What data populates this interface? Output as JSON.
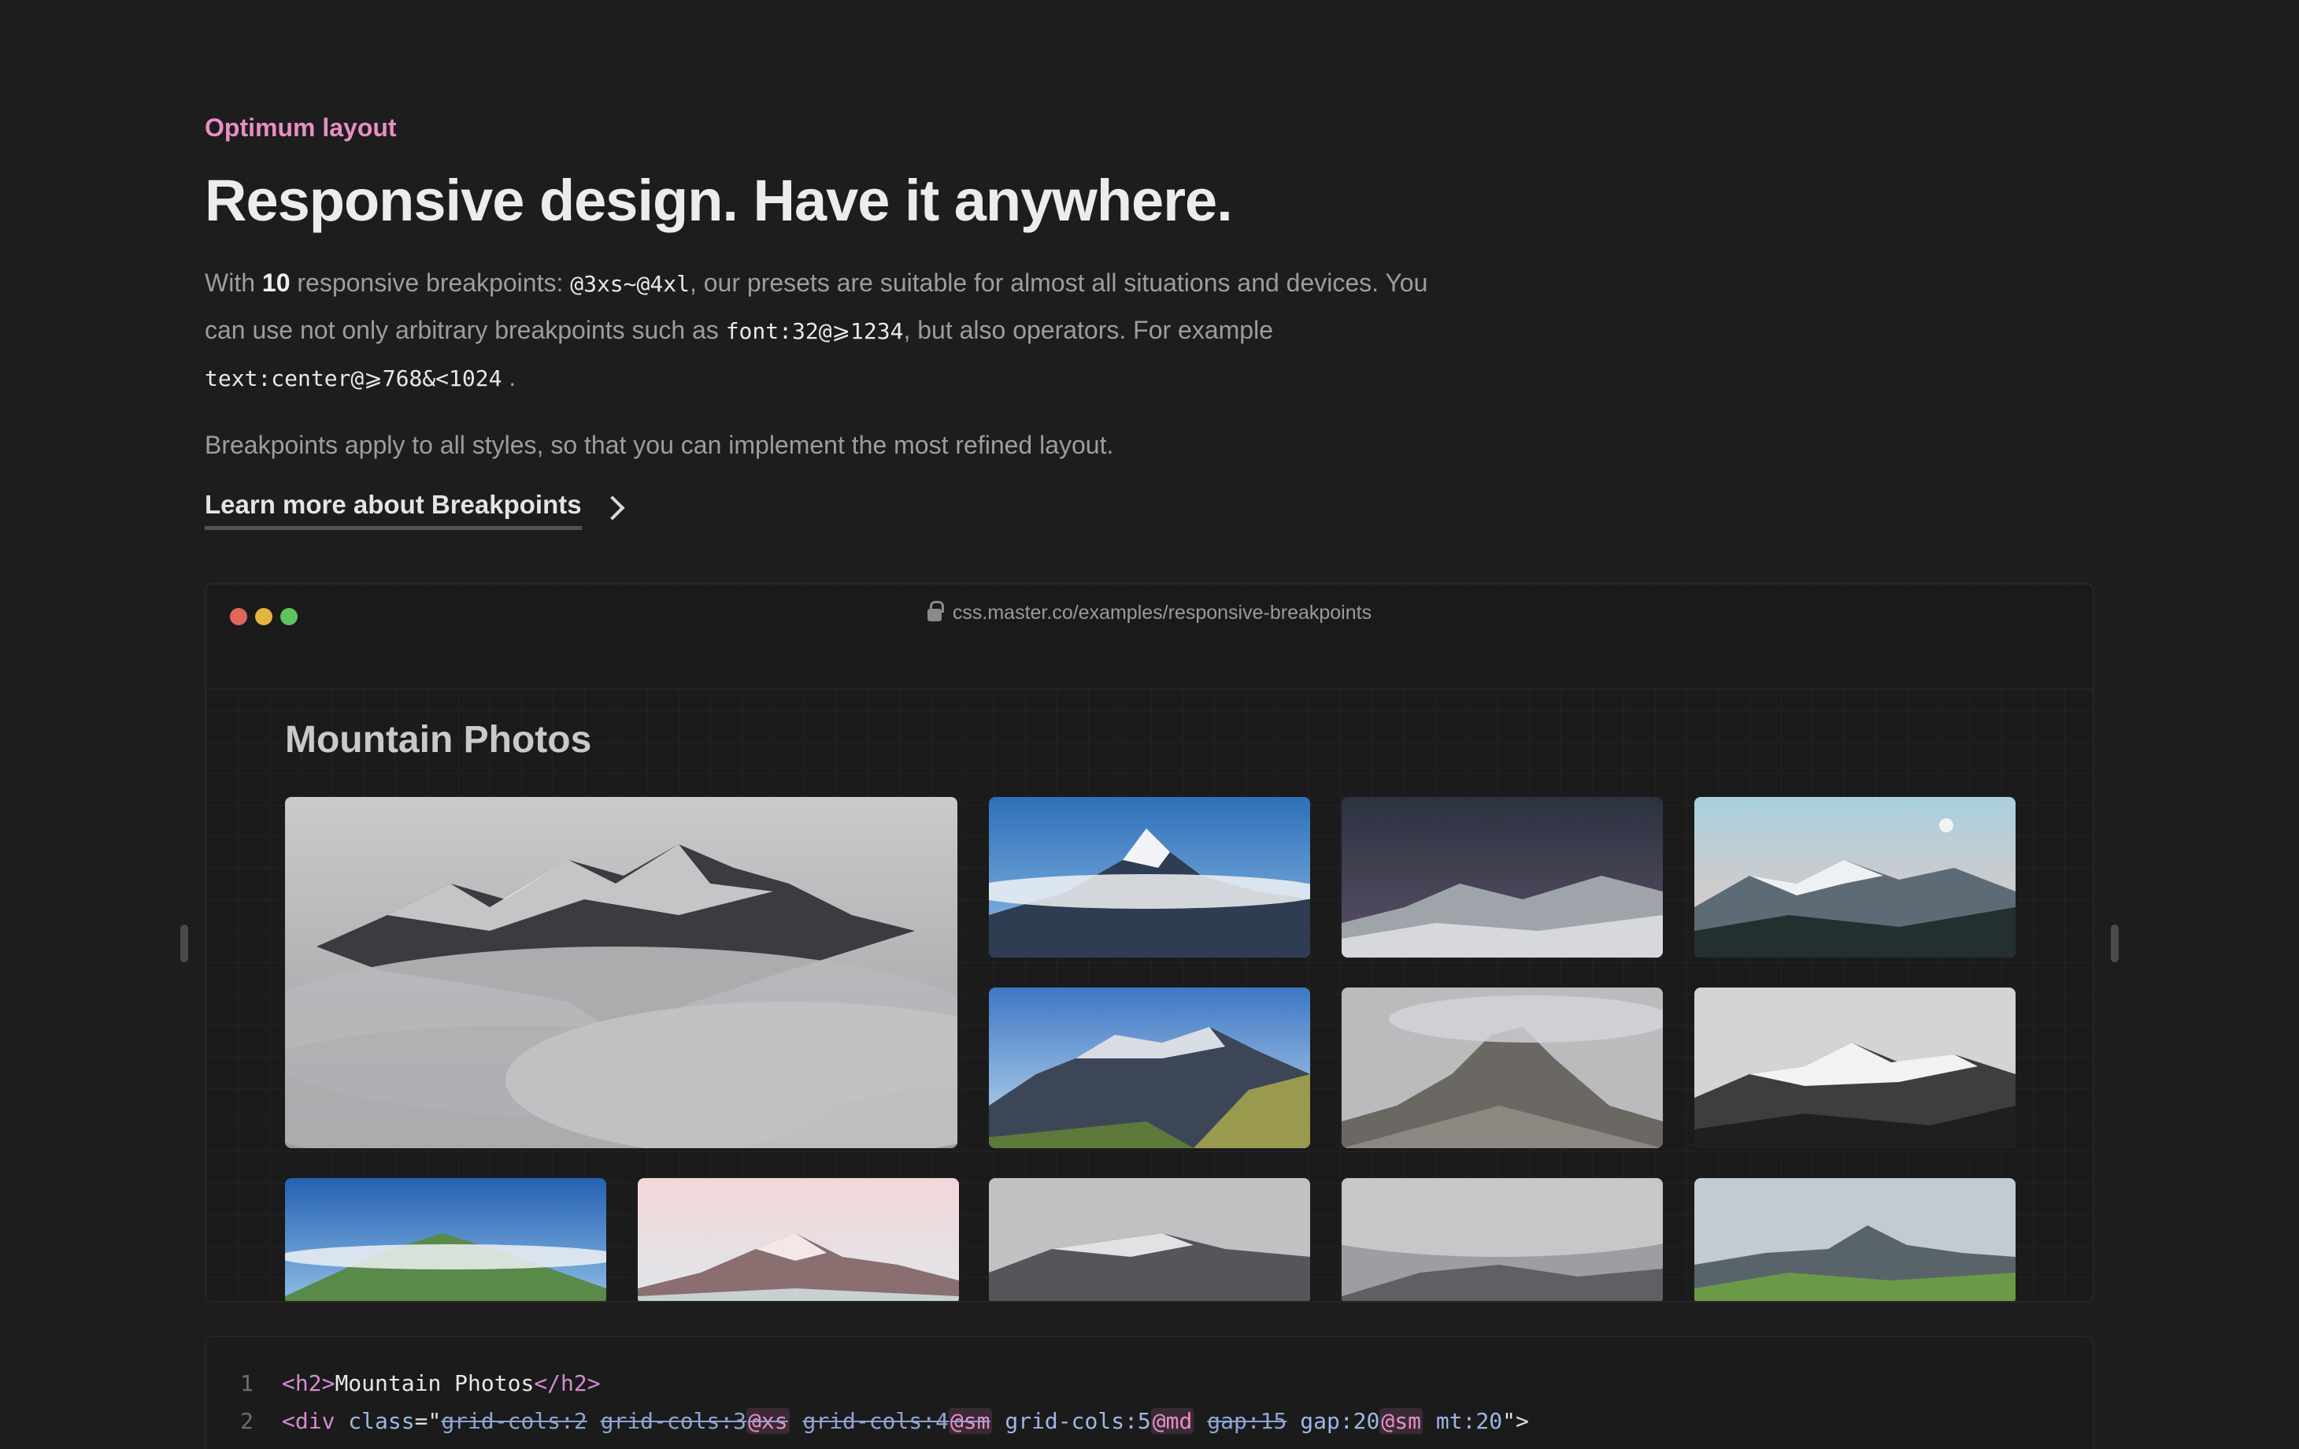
{
  "section": {
    "eyebrow": "Optimum layout",
    "headline": "Responsive design. Have it anywhere.",
    "p1_a": "With ",
    "p1_count": "10",
    "p1_b": " responsive breakpoints: ",
    "p1_code1": "@3xs~@4xl",
    "p1_c": ", our presets are suitable for almost all situations and devices. You can use not only arbitrary breakpoints such as ",
    "p1_code2": "font:32@⩾1234",
    "p1_d": ", but also operators. For example ",
    "p1_code3": "text:center@⩾768&<1024",
    "p1_e": " .",
    "p2": "Breakpoints apply to all styles, so that you can implement the most refined layout.",
    "learn_more": "Learn more about Breakpoints"
  },
  "browser": {
    "url": "css.master.co/examples/responsive-breakpoints",
    "gallery_title": "Mountain Photos"
  },
  "code": {
    "line1_no": "1",
    "line1_open": "<h2>",
    "line1_text": "Mountain Photos",
    "line1_close": "</h2>",
    "line2_no": "2",
    "line2_tag": "<div ",
    "line2_attr": "class",
    "line2_eq": "=\"",
    "line2_s1": "grid-cols:2",
    "line2_s2a": "grid-cols:3",
    "line2_s2b": "@xs",
    "line2_s3a": "grid-cols:4",
    "line2_s3b": "@sm",
    "line2_c1a": "grid-cols:5",
    "line2_c1b": "@md",
    "line2_s4": "gap:15",
    "line2_c2a": "gap:20",
    "line2_c2b": "@sm",
    "line2_c3": "mt:20",
    "line2_end": "\">"
  },
  "colors": {
    "accent": "#e88ec6",
    "background": "#1d1d1d",
    "dot_red": "#e0675a",
    "dot_yellow": "#e3b441",
    "dot_green": "#5fc45b"
  }
}
